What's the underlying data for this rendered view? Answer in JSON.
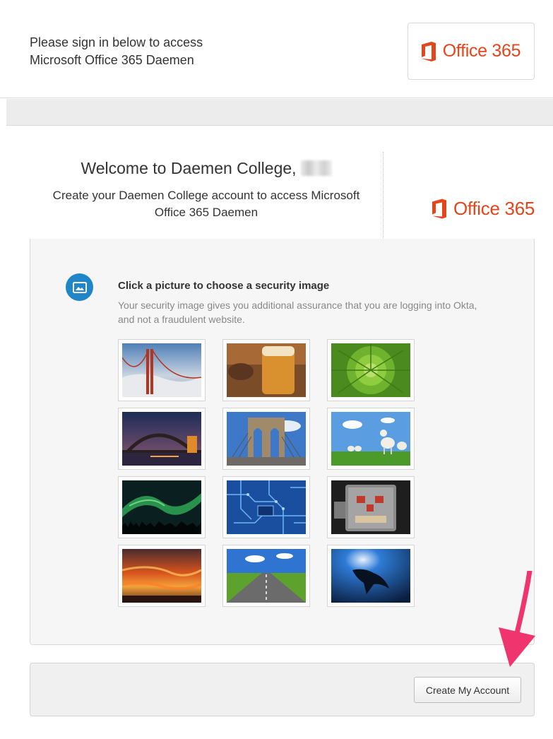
{
  "header": {
    "intro_line1": "Please sign in below to access",
    "intro_line2": "Microsoft Office 365 Daemen",
    "logo_text": "Office 365"
  },
  "welcome": {
    "title": "Welcome to Daemen College,",
    "subtitle_line1": "Create your Daemen College account to access Microsoft",
    "subtitle_line2": "Office 365 Daemen",
    "logo_text": "Office 365"
  },
  "security_image": {
    "icon": "picture-icon",
    "title": "Click a picture to choose a security image",
    "description": "Your security image gives you additional assurance that you are logging into Okta, and not a fraudulent website.",
    "images": [
      "golden-gate-bridge",
      "beer-glass",
      "green-succulent",
      "sydney-harbour-bridge",
      "brooklyn-bridge",
      "lambs-on-grass",
      "aurora-borealis",
      "circuit-board",
      "toy-robot",
      "sunset-clouds",
      "open-road",
      "manta-ray"
    ]
  },
  "footer": {
    "create_button_label": "Create My Account"
  },
  "colors": {
    "office_orange": "#e3461d",
    "icon_blue": "#1f86c8",
    "arrow_pink": "#f0346e"
  }
}
